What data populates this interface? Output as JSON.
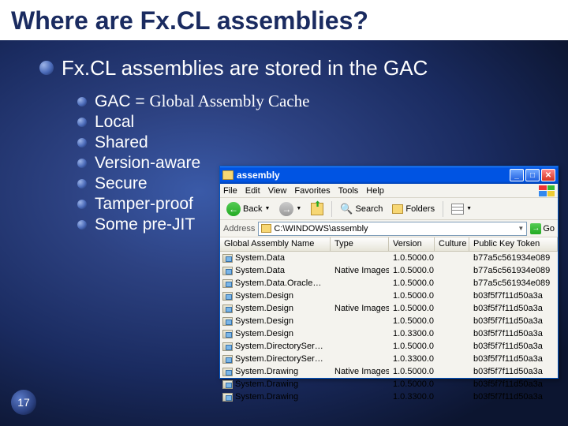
{
  "slide": {
    "title": "Where are Fx.CL assemblies?",
    "main_point": "Fx.CL assemblies are stored in the GAC",
    "gac_label": "GAC = ",
    "gac_expansion": "Global Assembly Cache",
    "bullets": [
      "Local",
      "Shared",
      "Version-aware",
      "Secure",
      "Tamper-proof",
      "Some pre-JIT"
    ],
    "page_number": "17"
  },
  "explorer": {
    "title": "assembly",
    "menu": {
      "file": "File",
      "edit": "Edit",
      "view": "View",
      "favorites": "Favorites",
      "tools": "Tools",
      "help": "Help"
    },
    "toolbar": {
      "back": "Back",
      "search": "Search",
      "folders": "Folders"
    },
    "address": {
      "label": "Address",
      "value": "C:\\WINDOWS\\assembly",
      "go": "Go"
    },
    "columns": {
      "name": "Global Assembly Name",
      "type": "Type",
      "version": "Version",
      "culture": "Culture",
      "pkt": "Public Key Token"
    },
    "rows": [
      {
        "name": "System.Data",
        "type": "",
        "version": "1.0.5000.0",
        "culture": "",
        "pkt": "b77a5c561934e089"
      },
      {
        "name": "System.Data",
        "type": "Native Images",
        "version": "1.0.5000.0",
        "culture": "",
        "pkt": "b77a5c561934e089"
      },
      {
        "name": "System.Data.OracleClient",
        "type": "",
        "version": "1.0.5000.0",
        "culture": "",
        "pkt": "b77a5c561934e089"
      },
      {
        "name": "System.Design",
        "type": "",
        "version": "1.0.5000.0",
        "culture": "",
        "pkt": "b03f5f7f11d50a3a"
      },
      {
        "name": "System.Design",
        "type": "Native Images",
        "version": "1.0.5000.0",
        "culture": "",
        "pkt": "b03f5f7f11d50a3a"
      },
      {
        "name": "System.Design",
        "type": "",
        "version": "1.0.5000.0",
        "culture": "",
        "pkt": "b03f5f7f11d50a3a"
      },
      {
        "name": "System.Design",
        "type": "",
        "version": "1.0.3300.0",
        "culture": "",
        "pkt": "b03f5f7f11d50a3a"
      },
      {
        "name": "System.DirectoryServices",
        "type": "",
        "version": "1.0.5000.0",
        "culture": "",
        "pkt": "b03f5f7f11d50a3a"
      },
      {
        "name": "System.DirectoryServices",
        "type": "",
        "version": "1.0.3300.0",
        "culture": "",
        "pkt": "b03f5f7f11d50a3a"
      },
      {
        "name": "System.Drawing",
        "type": "Native Images",
        "version": "1.0.5000.0",
        "culture": "",
        "pkt": "b03f5f7f11d50a3a"
      },
      {
        "name": "System.Drawing",
        "type": "",
        "version": "1.0.5000.0",
        "culture": "",
        "pkt": "b03f5f7f11d50a3a"
      },
      {
        "name": "System.Drawing",
        "type": "",
        "version": "1.0.3300.0",
        "culture": "",
        "pkt": "b03f5f7f11d50a3a"
      }
    ]
  }
}
